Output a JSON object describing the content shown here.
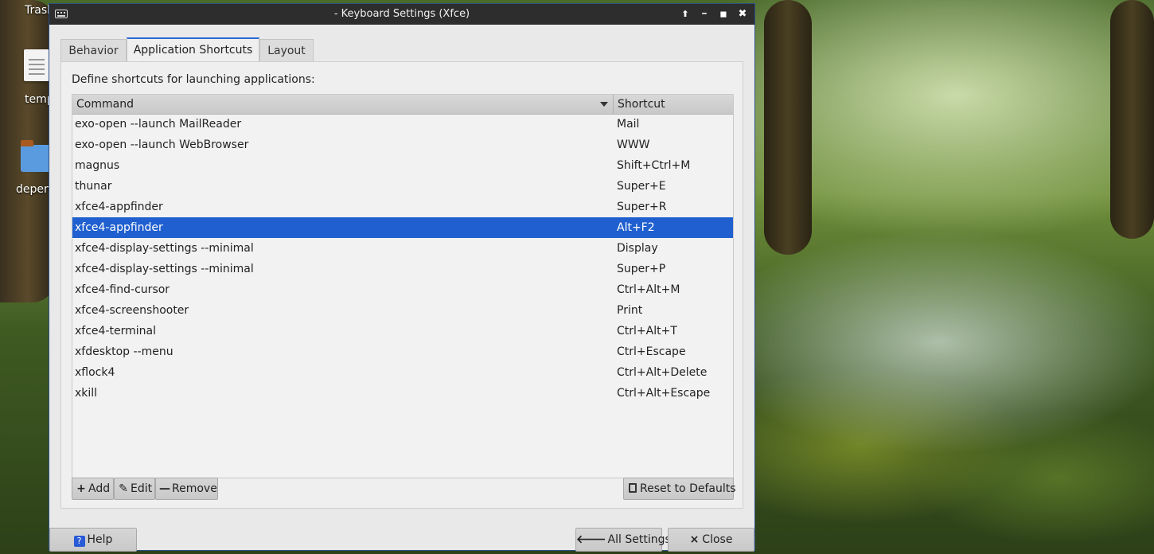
{
  "desktop": {
    "icons": [
      {
        "label": "Trash",
        "icon": "trash-icon"
      },
      {
        "label": "temp",
        "icon": "document-icon"
      },
      {
        "label": "depen",
        "icon": "folder-icon"
      }
    ]
  },
  "window": {
    "title": "- Keyboard Settings (Xfce)",
    "app_icon": "keyboard-icon",
    "controls": [
      "maximize-up-icon",
      "minimize-icon",
      "restore-icon",
      "close-icon"
    ],
    "control_glyphs": {
      "up": "⬆",
      "minimize": "━",
      "restore": "◼",
      "close": "✖"
    }
  },
  "tabs": [
    {
      "label": "Behavior",
      "active": false
    },
    {
      "label": "Application Shortcuts",
      "active": true
    },
    {
      "label": "Layout",
      "active": false
    }
  ],
  "panel": {
    "description": "Define shortcuts for launching applications:",
    "columns": {
      "command": "Command",
      "shortcut": "Shortcut"
    },
    "sort": "descending",
    "rows": [
      {
        "command": "exo-open --launch MailReader",
        "shortcut": "Mail",
        "selected": false
      },
      {
        "command": "exo-open --launch WebBrowser",
        "shortcut": "WWW",
        "selected": false
      },
      {
        "command": "magnus",
        "shortcut": "Shift+Ctrl+M",
        "selected": false
      },
      {
        "command": "thunar",
        "shortcut": "Super+E",
        "selected": false
      },
      {
        "command": "xfce4-appfinder",
        "shortcut": "Super+R",
        "selected": false
      },
      {
        "command": "xfce4-appfinder",
        "shortcut": "Alt+F2",
        "selected": true
      },
      {
        "command": "xfce4-display-settings --minimal",
        "shortcut": "Display",
        "selected": false
      },
      {
        "command": "xfce4-display-settings --minimal",
        "shortcut": "Super+P",
        "selected": false
      },
      {
        "command": "xfce4-find-cursor",
        "shortcut": "Ctrl+Alt+M",
        "selected": false
      },
      {
        "command": "xfce4-screenshooter",
        "shortcut": "Print",
        "selected": false
      },
      {
        "command": "xfce4-terminal",
        "shortcut": "Ctrl+Alt+T",
        "selected": false
      },
      {
        "command": "xfdesktop --menu",
        "shortcut": "Ctrl+Escape",
        "selected": false
      },
      {
        "command": "xflock4",
        "shortcut": "Ctrl+Alt+Delete",
        "selected": false
      },
      {
        "command": "xkill",
        "shortcut": "Ctrl+Alt+Escape",
        "selected": false
      }
    ],
    "toolbar": {
      "add": {
        "label": "Add",
        "glyph": "+"
      },
      "edit": {
        "label": "Edit",
        "glyph": "✎"
      },
      "remove": {
        "label": "Remove",
        "glyph": "—"
      },
      "reset": {
        "label": "Reset to Defaults"
      }
    }
  },
  "footer": {
    "help": {
      "label": "Help",
      "glyph": "?"
    },
    "all_settings": {
      "label": "All Settings",
      "glyph": "🡐"
    },
    "close": {
      "label": "Close",
      "glyph": "×"
    }
  },
  "colors": {
    "selection": "#1f5fcf",
    "titlebar": "#2d2d2d",
    "active_tab_accent": "#2b6bd6"
  }
}
